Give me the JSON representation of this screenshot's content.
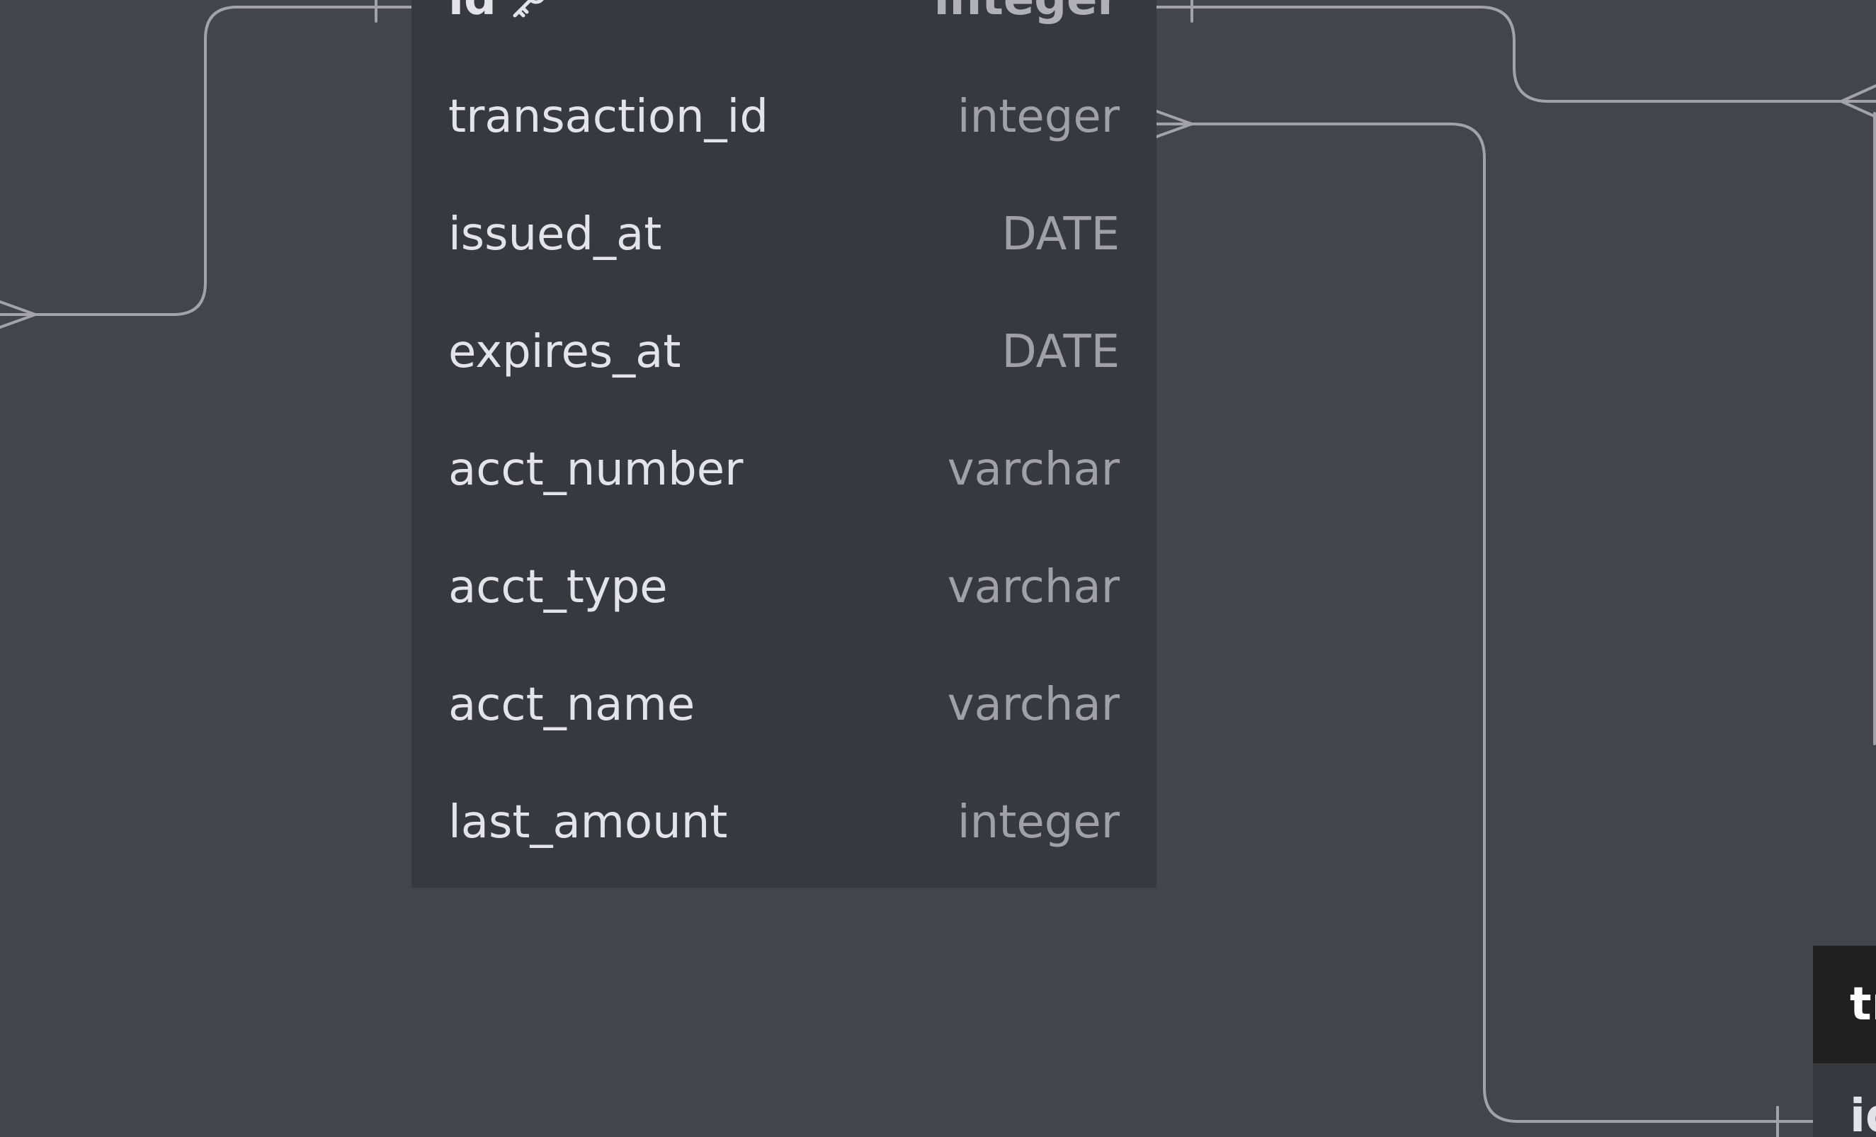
{
  "diagram": {
    "main_table": {
      "columns": [
        {
          "name": "id",
          "type": "integer",
          "primary_key": true
        },
        {
          "name": "transaction_id",
          "type": "integer"
        },
        {
          "name": "issued_at",
          "type": "DATE"
        },
        {
          "name": "expires_at",
          "type": "DATE"
        },
        {
          "name": "acct_number",
          "type": "varchar"
        },
        {
          "name": "acct_type",
          "type": "varchar"
        },
        {
          "name": "acct_name",
          "type": "varchar"
        },
        {
          "name": "last_amount",
          "type": "integer"
        }
      ]
    },
    "partial_table": {
      "title_visible": "tr",
      "first_column_visible": "id"
    },
    "colors": {
      "canvas": "#44444c",
      "table_body": "#38383f",
      "table_header": "#202020",
      "connector": "#a2a2a8",
      "column_name_text": "#e3e3e8",
      "column_type_text": "#a0a0a6"
    },
    "icons": {
      "primary_key": "key-icon"
    }
  }
}
